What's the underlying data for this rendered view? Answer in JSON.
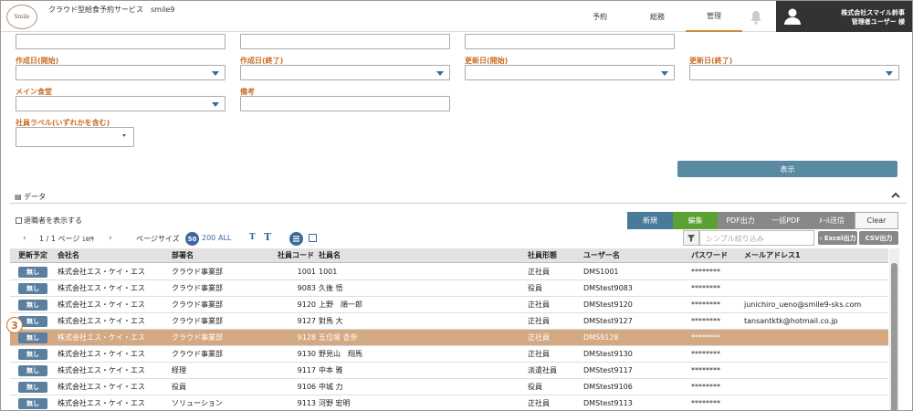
{
  "header": {
    "logo_text": "Smile",
    "service_title": "クラウド型給食予約サービス　smile9",
    "nav": [
      {
        "label": "予約"
      },
      {
        "label": "総務"
      },
      {
        "label": "管理"
      }
    ],
    "company": "株式会社スマイル鈴事",
    "user": "管理者ユーザー 様"
  },
  "form": {
    "created_from": "作成日(開始)",
    "created_to": "作成日(終了)",
    "updated_from": "更新日(開始)",
    "updated_to": "更新日(終了)",
    "main_cafeteria": "メイン食堂",
    "remarks": "備考",
    "employee_label": "社員ラベル(いずれかを含む)",
    "show_button": "表示"
  },
  "section": {
    "title": "データ",
    "retired_label": "退職者を表示する"
  },
  "pager": {
    "page": "1 / 1 ページ",
    "count": "18件",
    "page_size_label": "ページサイズ",
    "sizes": [
      "50",
      "200",
      "ALL"
    ]
  },
  "actions": {
    "new": "新規",
    "edit": "編集",
    "pdf": "PDF出力",
    "bulk_pdf": "一括PDF",
    "mail": "ﾒｰﾙ送信",
    "clear": "Clear",
    "filter_placeholder": "シンプル絞り込み",
    "excel": "‹ Excel出力",
    "csv": "CSV出力"
  },
  "table": {
    "headers": [
      "更新予定",
      "会社名",
      "部署名",
      "社員コード",
      "社員名",
      "社員形態",
      "ユーザー名",
      "パスワード",
      "メールアドレス1"
    ],
    "rows": [
      {
        "upd": "無し",
        "company": "株式会社エス・ケイ・エス",
        "dept": "クラウド事業部",
        "code": "1001",
        "name": "1001",
        "type": "正社員",
        "user": "DMS1001",
        "pw": "********",
        "mail": ""
      },
      {
        "upd": "無し",
        "company": "株式会社エス・ケイ・エス",
        "dept": "クラウド事業部",
        "code": "9083",
        "name": "久後 悟",
        "type": "役員",
        "user": "DMStest9083",
        "pw": "********",
        "mail": ""
      },
      {
        "upd": "無し",
        "company": "株式会社エス・ケイ・エス",
        "dept": "クラウド事業部",
        "code": "9120",
        "name": "上野　順一郎",
        "type": "正社員",
        "user": "DMStest9120",
        "pw": "********",
        "mail": "junichiro_ueno@smile9-sks.com"
      },
      {
        "upd": "無し",
        "company": "株式会社エス・ケイ・エス",
        "dept": "クラウド事業部",
        "code": "9127",
        "name": "對馬 大",
        "type": "正社員",
        "user": "DMStest9127",
        "pw": "********",
        "mail": "tansantktk@hotmail.co.jp"
      },
      {
        "upd": "無し",
        "company": "株式会社エス・ケイ・エス",
        "dept": "クラウド事業部",
        "code": "9128",
        "name": "五位塚 杏奈",
        "type": "正社員",
        "user": "DMS9128",
        "pw": "********",
        "mail": ""
      },
      {
        "upd": "無し",
        "company": "株式会社エス・ケイ・エス",
        "dept": "クラウド事業部",
        "code": "9130",
        "name": "野見山　翔馬",
        "type": "正社員",
        "user": "DMStest9130",
        "pw": "********",
        "mail": ""
      },
      {
        "upd": "無し",
        "company": "株式会社エス・ケイ・エス",
        "dept": "経理",
        "code": "9117",
        "name": "中本 雅",
        "type": "派遣社員",
        "user": "DMStest9117",
        "pw": "********",
        "mail": ""
      },
      {
        "upd": "無し",
        "company": "株式会社エス・ケイ・エス",
        "dept": "役員",
        "code": "9106",
        "name": "中城 力",
        "type": "役員",
        "user": "DMStest9106",
        "pw": "********",
        "mail": ""
      },
      {
        "upd": "無し",
        "company": "株式会社エス・ケイ・エス",
        "dept": "ソリューション",
        "code": "9113",
        "name": "河野 宏明",
        "type": "正社員",
        "user": "DMStest9113",
        "pw": "********",
        "mail": ""
      }
    ]
  },
  "step_marker": "3"
}
